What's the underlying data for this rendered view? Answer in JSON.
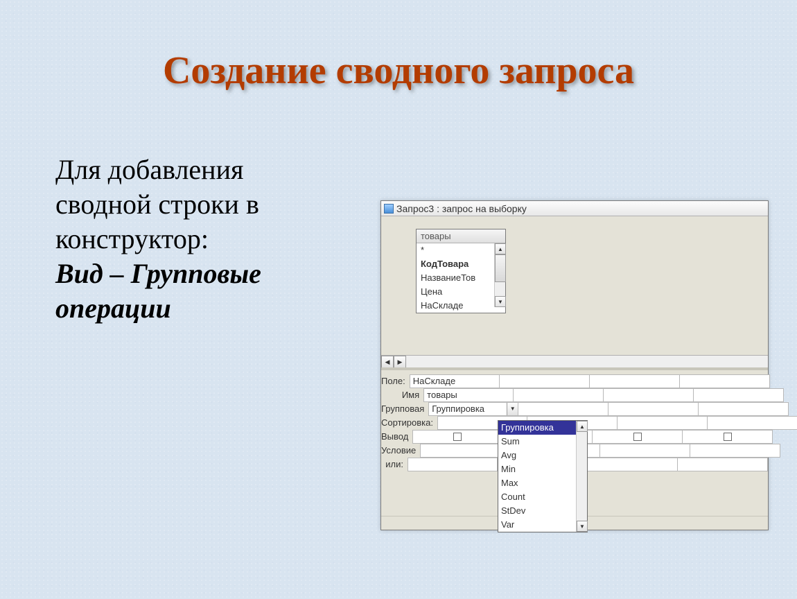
{
  "title": "Создание сводного запроса",
  "body": {
    "line1": "Для добавления",
    "line2": "сводной строки в",
    "line3": "конструктор:",
    "emph": "Вид – Групповые операции"
  },
  "window": {
    "title": "Запрос3 : запрос на выборку",
    "table": {
      "name": "товары",
      "fields": [
        "*",
        "КодТовара",
        "НазваниеТов",
        "Цена",
        "НаСкладе"
      ]
    },
    "grid": {
      "labels": {
        "field": "Поле:",
        "tablename": "Имя таблицы:",
        "groupop": "Групповая операция:",
        "sort": "Сортировка:",
        "show": "Вывод на экран:",
        "criteria": "Условие отбора:",
        "or": "или:"
      },
      "col1": {
        "field": "НаСкладе",
        "tablename": "товары",
        "groupop": "Группировка"
      },
      "dropdown": {
        "items": [
          "Группировка",
          "Sum",
          "Avg",
          "Min",
          "Max",
          "Count",
          "StDev",
          "Var"
        ],
        "selected": "Группировка"
      }
    }
  }
}
